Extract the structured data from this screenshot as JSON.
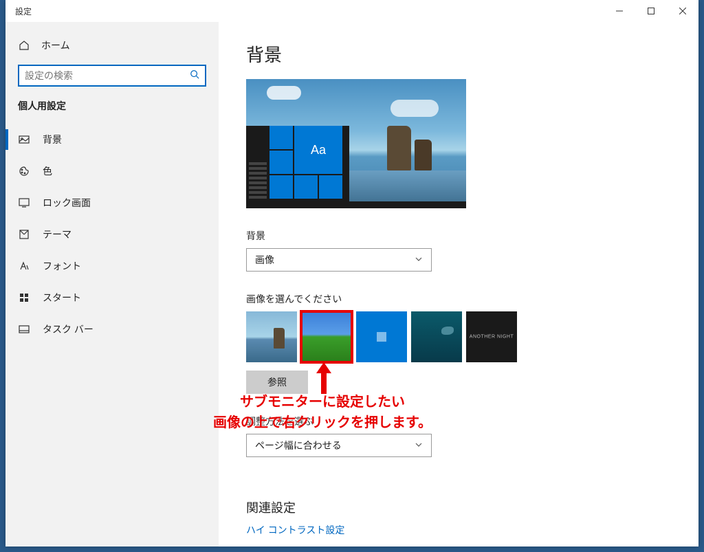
{
  "window": {
    "title": "設定"
  },
  "sidebar": {
    "home": "ホーム",
    "search_placeholder": "設定の検索",
    "section": "個人用設定",
    "items": [
      {
        "label": "背景",
        "icon": "picture-icon",
        "active": true
      },
      {
        "label": "色",
        "icon": "palette-icon"
      },
      {
        "label": "ロック画面",
        "icon": "lock-screen-icon"
      },
      {
        "label": "テーマ",
        "icon": "theme-icon"
      },
      {
        "label": "フォント",
        "icon": "font-icon"
      },
      {
        "label": "スタート",
        "icon": "start-icon"
      },
      {
        "label": "タスク バー",
        "icon": "taskbar-icon"
      }
    ]
  },
  "main": {
    "title": "背景",
    "preview_tile_text": "Aa",
    "bg_label": "背景",
    "bg_dropdown_value": "画像",
    "choose_label": "画像を選んでください",
    "browse": "参照",
    "fit_label": "調整方法を選ぶ",
    "fit_value": "ページ幅に合わせる",
    "related_title": "関連設定",
    "related_link": "ハイ コントラスト設定"
  },
  "annotation": {
    "line1": "サブモニターに設定したい",
    "line2": "画像の上で右クリックを押します。"
  }
}
